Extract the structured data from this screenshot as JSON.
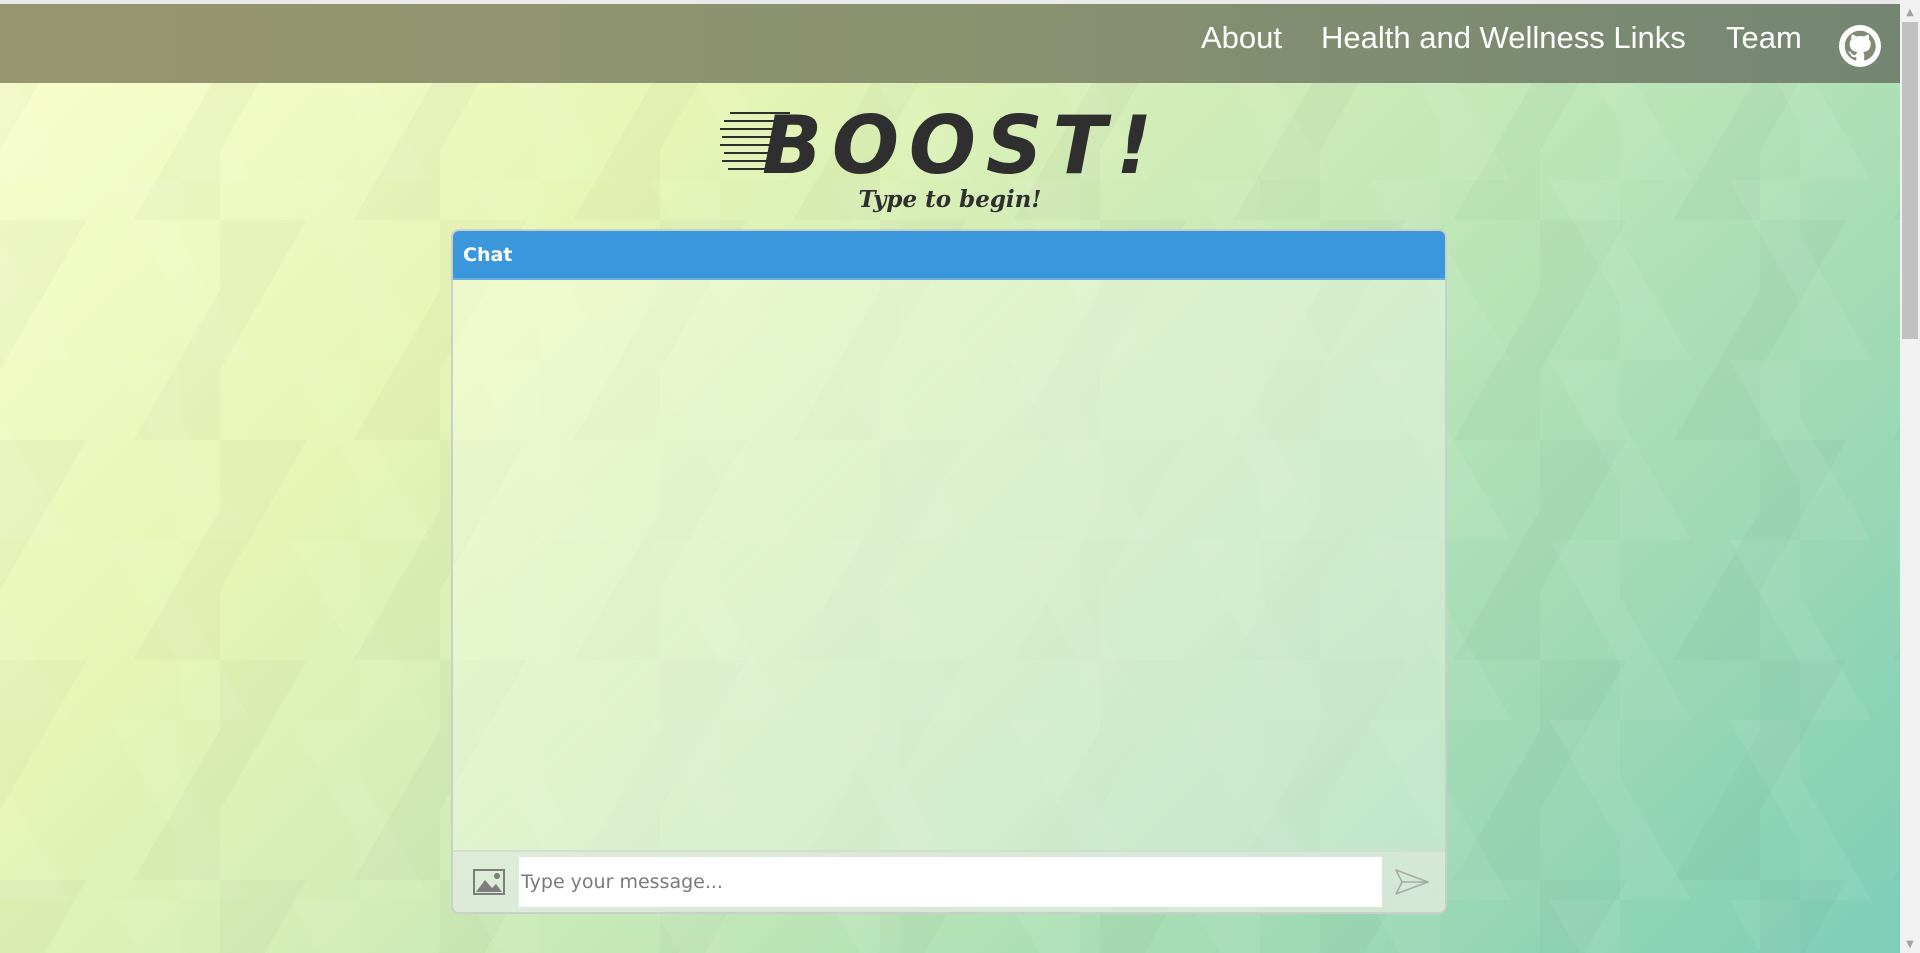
{
  "nav": {
    "links": [
      {
        "label": "About"
      },
      {
        "label": "Health and Wellness Links"
      },
      {
        "label": "Team"
      }
    ],
    "github_icon": "github-icon"
  },
  "hero": {
    "logo_text": "BOOST!",
    "tagline": "Type to begin!"
  },
  "chat": {
    "title": "Chat",
    "input_placeholder": "Type your message...",
    "input_value": "",
    "image_icon": "image-icon",
    "send_icon": "send-icon"
  },
  "colors": {
    "chat_header": "#3b97dc",
    "navbar": "#8a9270"
  }
}
